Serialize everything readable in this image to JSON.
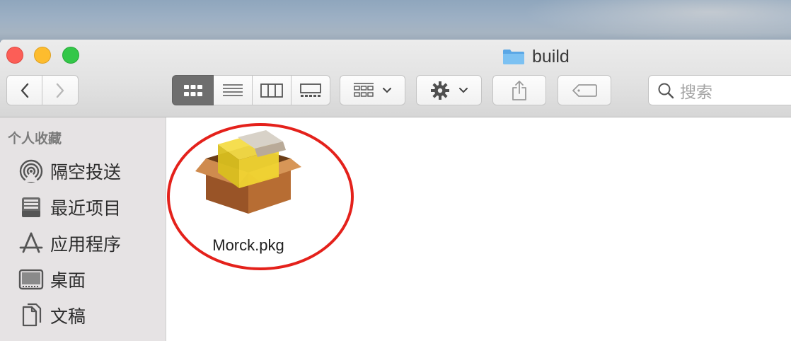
{
  "window": {
    "title": "build"
  },
  "search": {
    "placeholder": "搜索"
  },
  "sidebar": {
    "heading": "个人收藏",
    "items": [
      {
        "label": "隔空投送",
        "icon": "airdrop-icon"
      },
      {
        "label": "最近项目",
        "icon": "recents-icon"
      },
      {
        "label": "应用程序",
        "icon": "applications-icon"
      },
      {
        "label": "桌面",
        "icon": "desktop-icon"
      },
      {
        "label": "文稿",
        "icon": "documents-icon"
      }
    ]
  },
  "files": [
    {
      "name": "Morck.pkg",
      "icon": "package-icon"
    }
  ],
  "colors": {
    "close": "#fc5e57",
    "minimize": "#fdbc2e",
    "maximize": "#33c748",
    "annotation": "#e4211b",
    "folder": "#6db3ea"
  }
}
